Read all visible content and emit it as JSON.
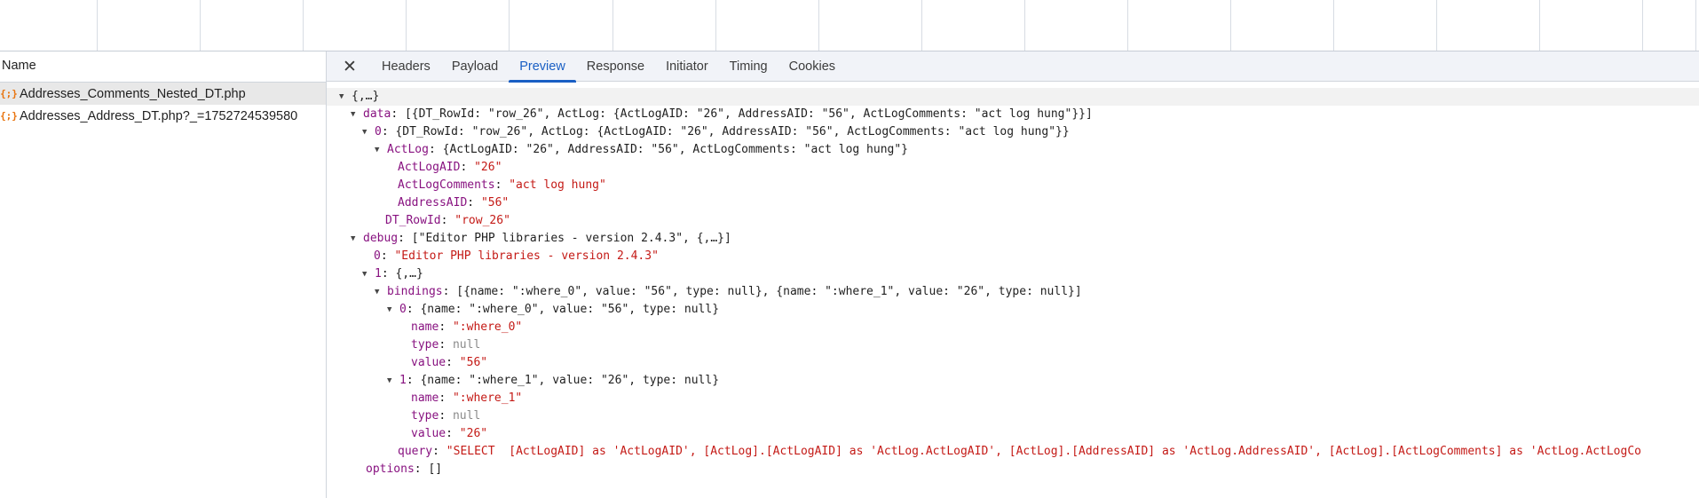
{
  "names_panel": {
    "header": "Name",
    "requests": [
      {
        "icon": "{;}",
        "name": "Addresses_Comments_Nested_DT.php",
        "selected": true
      },
      {
        "icon": "{;}",
        "name": "Addresses_Address_DT.php?_=1752724539580",
        "selected": false
      }
    ]
  },
  "tabs": [
    "Headers",
    "Payload",
    "Preview",
    "Response",
    "Initiator",
    "Timing",
    "Cookies"
  ],
  "active_tab": "Preview",
  "close_label": "✕",
  "tree": {
    "root": "{,…}",
    "data_key": "data",
    "data_summary": "[{DT_RowId: \"row_26\", ActLog: {ActLogAID: \"26\", AddressAID: \"56\", ActLogComments: \"act log hung\"}}]",
    "data0_key": "0",
    "data0_summary": "{DT_RowId: \"row_26\", ActLog: {ActLogAID: \"26\", AddressAID: \"56\", ActLogComments: \"act log hung\"}}",
    "actlog_key": "ActLog",
    "actlog_summary": "{ActLogAID: \"26\", AddressAID: \"56\", ActLogComments: \"act log hung\"}",
    "actlogaid_key": "ActLogAID",
    "actlogaid_val": "\"26\"",
    "actlogcomments_key": "ActLogComments",
    "actlogcomments_val": "\"act log hung\"",
    "addressaid_key": "AddressAID",
    "addressaid_val": "\"56\"",
    "rowid_key": "DT_RowId",
    "rowid_val": "\"row_26\"",
    "debug_key": "debug",
    "debug_summary": "[\"Editor PHP libraries - version 2.4.3\", {,…}]",
    "debug0_key": "0",
    "debug0_val": "\"Editor PHP libraries - version 2.4.3\"",
    "debug1_key": "1",
    "debug1_summary": "{,…}",
    "bindings_key": "bindings",
    "bindings_summary": "[{name: \":where_0\", value: \"56\", type: null}, {name: \":where_1\", value: \"26\", type: null}]",
    "b0_key": "0",
    "b0_summary": "{name: \":where_0\", value: \"56\", type: null}",
    "b0_name_key": "name",
    "b0_name_val": "\":where_0\"",
    "b0_type_key": "type",
    "b0_type_val": "null",
    "b0_value_key": "value",
    "b0_value_val": "\"56\"",
    "b1_key": "1",
    "b1_summary": "{name: \":where_1\", value: \"26\", type: null}",
    "b1_name_key": "name",
    "b1_name_val": "\":where_1\"",
    "b1_type_key": "type",
    "b1_type_val": "null",
    "b1_value_key": "value",
    "b1_value_val": "\"26\"",
    "query_key": "query",
    "query_val": "\"SELECT  [ActLogAID] as 'ActLogAID', [ActLog].[ActLogAID] as 'ActLog.ActLogAID', [ActLog].[AddressAID] as 'ActLog.AddressAID', [ActLog].[ActLogComments] as 'ActLog.ActLogCo",
    "options_key": "options",
    "options_val": "[]"
  },
  "colors": {
    "key": "#881280",
    "string": "#c41a16",
    "null": "#8a8a8a",
    "active_tab": "#1a5fc4",
    "xhr_icon": "#e8710a"
  }
}
